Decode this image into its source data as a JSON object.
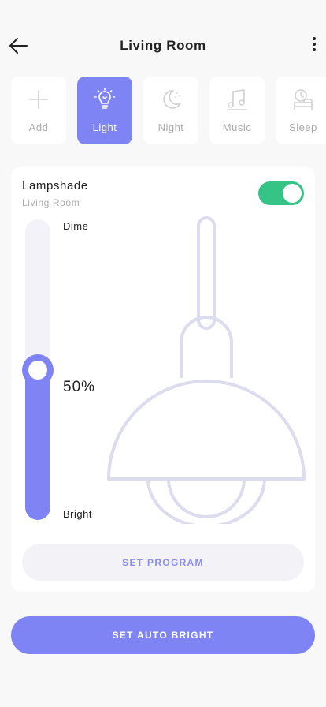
{
  "header": {
    "title": "Living Room",
    "back_icon": "arrow-left-icon",
    "menu_icon": "more-vertical-icon"
  },
  "tabs": [
    {
      "label": "Add",
      "icon": "plus-icon",
      "active": false
    },
    {
      "label": "Light",
      "icon": "lightbulb-icon",
      "active": true
    },
    {
      "label": "Night",
      "icon": "moon-icon",
      "active": false
    },
    {
      "label": "Music",
      "icon": "music-note-icon",
      "active": false
    },
    {
      "label": "Sleep",
      "icon": "bed-clock-icon",
      "active": false
    }
  ],
  "device": {
    "name": "Lampshade",
    "room": "Living Room",
    "power_on": true,
    "brightness": {
      "top_label": "Dime",
      "bottom_label": "Bright",
      "value_text": "50%",
      "level_fraction": 0.5
    }
  },
  "actions": {
    "set_program": "SET PROGRAM",
    "auto_bright": "SET AUTO BRIGHT"
  },
  "colors": {
    "accent": "#7f84f5",
    "toggle_on": "#36c486",
    "lamp_outline": "#dcdcee",
    "muted_text": "#aaaaaa"
  }
}
